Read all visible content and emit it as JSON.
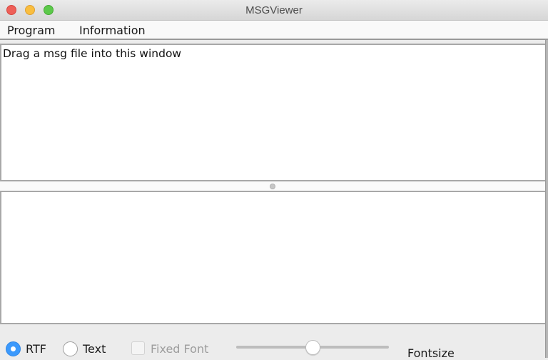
{
  "window": {
    "title": "MSGViewer",
    "buttons": [
      "close",
      "minimize",
      "maximize"
    ]
  },
  "menubar": {
    "items": [
      {
        "label": "Program"
      },
      {
        "label": "Information"
      }
    ]
  },
  "panes": {
    "top": {
      "text": "Drag a msg file into this window"
    },
    "bottom": {
      "text": ""
    }
  },
  "controls": {
    "format_options": [
      {
        "label": "RTF",
        "selected": true
      },
      {
        "label": "Text",
        "selected": false
      }
    ],
    "fixed_font": {
      "label": "Fixed Font",
      "checked": false,
      "enabled": false
    },
    "fontsize_slider": {
      "value_fraction": 0.5
    },
    "fontsize_label": "Fontsize"
  },
  "colors": {
    "accent": "#3b99fc",
    "close": "#ee5f58",
    "minimize": "#f9be3f",
    "maximize": "#5cc94a"
  }
}
